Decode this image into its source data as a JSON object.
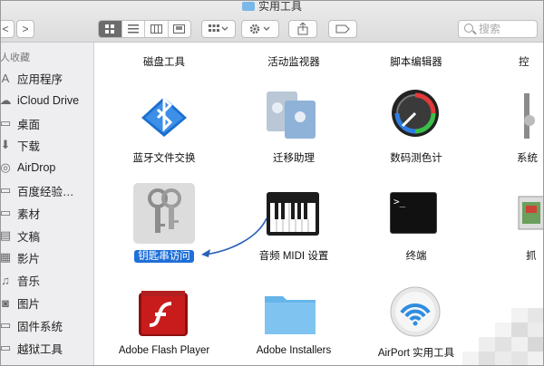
{
  "window": {
    "title": "实用工具"
  },
  "toolbar": {
    "back": "<",
    "forward": ">",
    "search_placeholder": "搜索"
  },
  "sidebar": {
    "header": "人收藏",
    "items": [
      {
        "label": "应用程序",
        "icon": "applications-icon"
      },
      {
        "label": "iCloud Drive",
        "icon": "cloud-icon"
      },
      {
        "label": "桌面",
        "icon": "desktop-icon"
      },
      {
        "label": "下载",
        "icon": "download-icon"
      },
      {
        "label": "AirDrop",
        "icon": "airdrop-icon"
      },
      {
        "label": "百度经验…",
        "icon": "folder-icon"
      },
      {
        "label": "素材",
        "icon": "folder-icon"
      },
      {
        "label": "文稿",
        "icon": "documents-icon"
      },
      {
        "label": "影片",
        "icon": "movies-icon"
      },
      {
        "label": "音乐",
        "icon": "music-icon"
      },
      {
        "label": "图片",
        "icon": "pictures-icon"
      },
      {
        "label": "固件系统",
        "icon": "folder-icon"
      },
      {
        "label": "越狱工具",
        "icon": "folder-icon"
      }
    ]
  },
  "content": {
    "row1": [
      "磁盘工具",
      "活动监视器",
      "脚本编辑器",
      "控"
    ],
    "row2": [
      "蓝牙文件交换",
      "迁移助理",
      "数码测色计",
      "系统"
    ],
    "row3": [
      "钥匙串访问",
      "音频 MIDI 设置",
      "终端",
      "抓"
    ],
    "row4": [
      "Adobe Flash Player",
      "Adobe Installers",
      "AirPort 实用工具"
    ],
    "selected_item": "钥匙串访问",
    "terminal_prompt": ">_"
  }
}
